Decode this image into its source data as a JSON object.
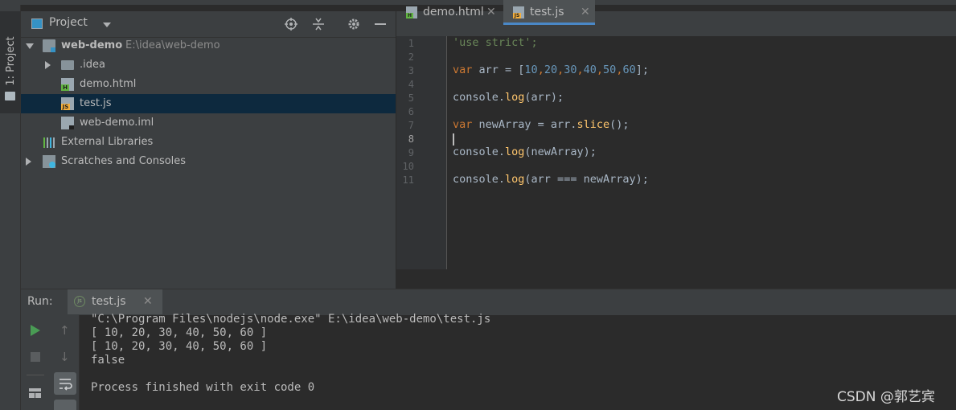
{
  "sidebar": {
    "stripe_label": "1: Project"
  },
  "project": {
    "title": "Project",
    "root": {
      "name": "web-demo",
      "path": "E:\\idea\\web-demo"
    },
    "items": [
      {
        "label": ".idea"
      },
      {
        "label": "demo.html"
      },
      {
        "label": "test.js"
      },
      {
        "label": "web-demo.iml"
      },
      {
        "label": "External Libraries"
      },
      {
        "label": "Scratches and Consoles"
      }
    ]
  },
  "editor": {
    "tabs": [
      {
        "label": "demo.html"
      },
      {
        "label": "test.js"
      }
    ],
    "line_numbers": [
      "1",
      "2",
      "3",
      "4",
      "5",
      "6",
      "7",
      "8",
      "9",
      "10",
      "11"
    ],
    "code": {
      "l1": "'use strict';",
      "l3_kw": "var",
      "l3_rest": " arr = [",
      "l3_nums": [
        "10",
        "20",
        "30",
        "40",
        "50",
        "60"
      ],
      "l3_end": "];",
      "l5_a": "console.",
      "l5_fn": "log",
      "l5_b": "(arr);",
      "l7_kw": "var",
      "l7_a": " newArray = arr.",
      "l7_fn": "slice",
      "l7_b": "();",
      "l9_a": "console.",
      "l9_fn": "log",
      "l9_b": "(newArray);",
      "l11_a": "console.",
      "l11_fn": "log",
      "l11_b": "(arr === newArray);"
    }
  },
  "run": {
    "label": "Run:",
    "tab_label": "test.js",
    "output": [
      "\"C:\\Program Files\\nodejs\\node.exe\" E:\\idea\\web-demo\\test.js",
      "[ 10, 20, 30, 40, 50, 60 ]",
      "[ 10, 20, 30, 40, 50, 60 ]",
      "false",
      "",
      "Process finished with exit code 0"
    ]
  },
  "watermark": "CSDN @郭艺宾",
  "colors": {
    "keyword": "#cc7832",
    "string": "#6a8759",
    "number": "#6897bb",
    "function": "#ffc66d",
    "selection": "#0d293e",
    "tab_underline": "#4a88c7"
  }
}
